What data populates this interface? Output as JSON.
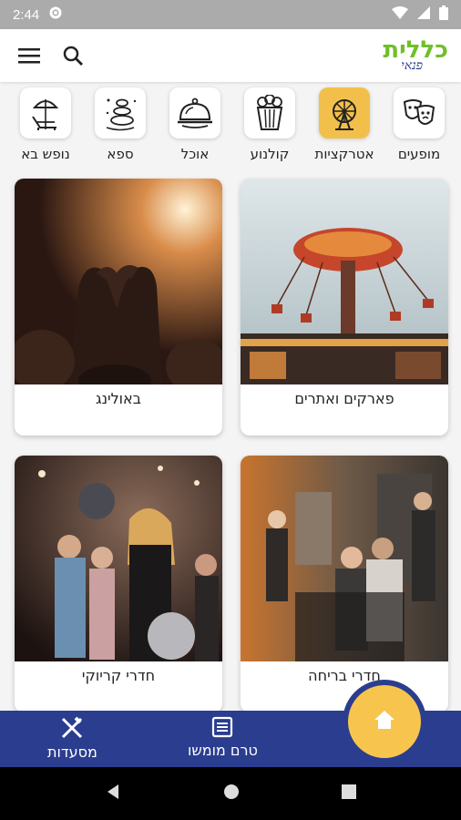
{
  "status_bar": {
    "time": "2:44",
    "icons": [
      "settings-icon",
      "wifi-icon",
      "signal-icon",
      "battery-icon"
    ]
  },
  "app_bar": {
    "logo_main": "כללית",
    "logo_sub": "פנאי",
    "menu_icon": "hamburger-menu-icon",
    "search_icon": "search-icon"
  },
  "categories": [
    {
      "label": "מופעים",
      "icon": "theater-masks-icon",
      "active": false
    },
    {
      "label": "אטרקציות",
      "icon": "ferris-wheel-icon",
      "active": true
    },
    {
      "label": "קולנוע",
      "icon": "popcorn-icon",
      "active": false
    },
    {
      "label": "אוכל",
      "icon": "food-cloche-icon",
      "active": false
    },
    {
      "label": "ספא",
      "icon": "spa-stones-icon",
      "active": false
    },
    {
      "label": "נופש בא",
      "icon": "beach-chair-icon",
      "active": false
    }
  ],
  "cards": [
    {
      "title": "פארקים ואתרים",
      "photo": "amusement-park-swing-ride"
    },
    {
      "title": "באולינג",
      "photo": "concert-crowd-heart-hands"
    },
    {
      "title": "חדרי בריחה",
      "photo": "escape-room-group"
    },
    {
      "title": "חדרי קריוקי",
      "photo": "karaoke-party"
    }
  ],
  "bottom_nav": {
    "restaurants": "מסעדות",
    "pre_launch": "טרם מומשו",
    "home_icon": "home-icon"
  },
  "colors": {
    "brand_green": "#6fbf2a",
    "brand_blue": "#2b3d8f",
    "accent_yellow": "#f7c54e"
  }
}
